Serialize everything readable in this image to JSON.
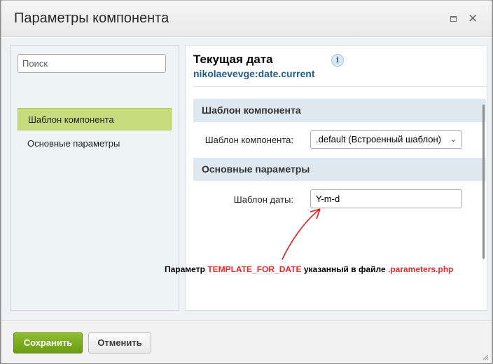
{
  "window": {
    "title": "Параметры компонента",
    "maximize_icon": "maximize-icon",
    "close_icon": "close-icon",
    "close_glyph": "✕"
  },
  "sidebar": {
    "search_placeholder": "Поиск",
    "items": [
      {
        "label": "Шаблон компонента",
        "active": true
      },
      {
        "label": "Основные параметры",
        "active": false
      }
    ]
  },
  "component": {
    "title": "Текущая дата",
    "code": "nikolaevevge:date.current",
    "info_glyph": "i"
  },
  "sections": [
    {
      "heading": "Шаблон компонента",
      "field_label": "Шаблон компонента:",
      "field_value": ".default (Встроенный шаблон)"
    },
    {
      "heading": "Основные параметры",
      "field_label": "Шаблон даты:",
      "field_value": "Y-m-d"
    }
  ],
  "annotation": {
    "prefix": "Параметр ",
    "param": "TEMPLATE_FOR_DATE",
    "middle": " указанный в файле ",
    "file": ".parameters.php"
  },
  "footer": {
    "save_label": "Сохранить",
    "cancel_label": "Отменить"
  },
  "colors": {
    "accent_green": "#7aab1e",
    "active_item": "#c5db7e",
    "annotation_red": "#e02b2b",
    "code_blue": "#215d89"
  }
}
